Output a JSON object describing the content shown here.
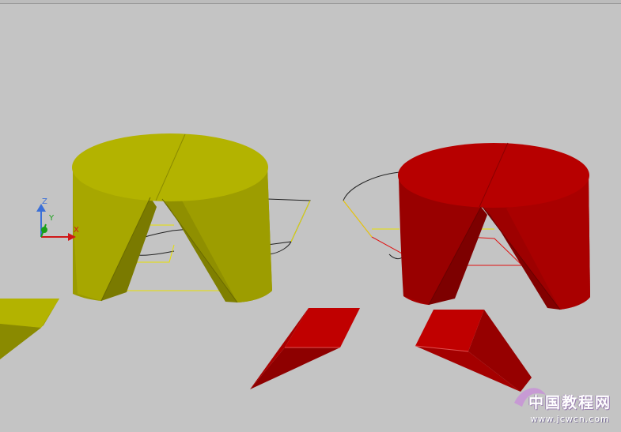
{
  "ucs": {
    "z_label": "Z",
    "y_label": "Y",
    "x_label": "X"
  },
  "watermark": {
    "title": "中国教程网",
    "url": "www.jcwcn.com"
  },
  "colors": {
    "background": "#c4c4c4",
    "yellow_solid": "#b0b000",
    "red_solid": "#b40000",
    "wire_black": "#222222",
    "wire_yellow": "#e8e000",
    "wire_red": "#e01010",
    "axis_z": "#3a6fd8",
    "axis_y": "#18a018",
    "axis_x": "#d01818"
  }
}
